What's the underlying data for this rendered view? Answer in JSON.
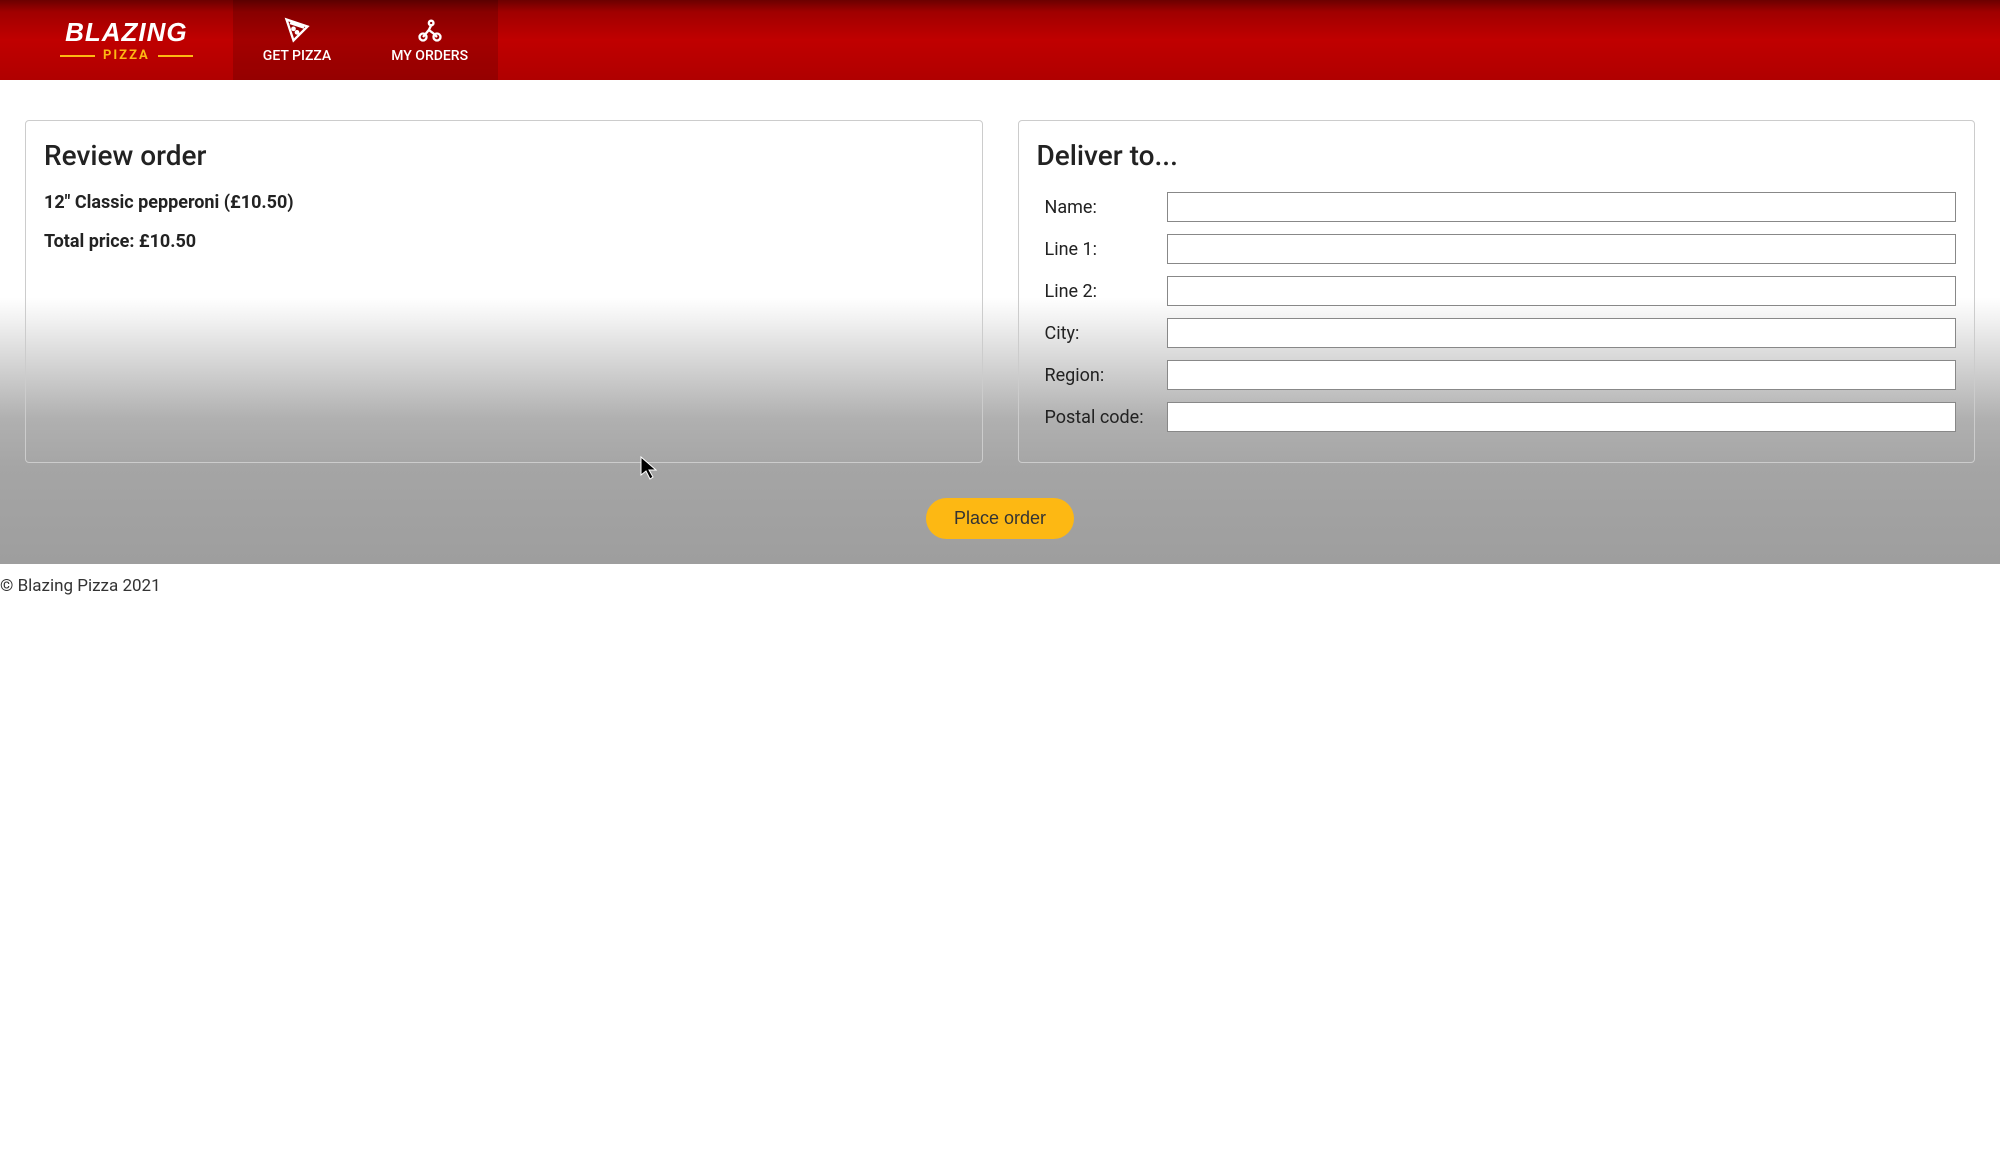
{
  "logo": {
    "main": "BLAZING",
    "sub": "PIZZA"
  },
  "nav": {
    "get_pizza": "GET PIZZA",
    "my_orders": "MY ORDERS"
  },
  "review": {
    "title": "Review order",
    "items": [
      {
        "text": "12\" Classic pepperoni (£10.50)"
      }
    ],
    "total_label": "Total price:",
    "total_value": "£10.50"
  },
  "deliver": {
    "title": "Deliver to...",
    "fields": {
      "name_label": "Name:",
      "line1_label": "Line 1:",
      "line2_label": "Line 2:",
      "city_label": "City:",
      "region_label": "Region:",
      "postal_label": "Postal code:"
    }
  },
  "actions": {
    "place_order": "Place order"
  },
  "footer": {
    "copyright": "© Blazing Pizza 2021"
  }
}
